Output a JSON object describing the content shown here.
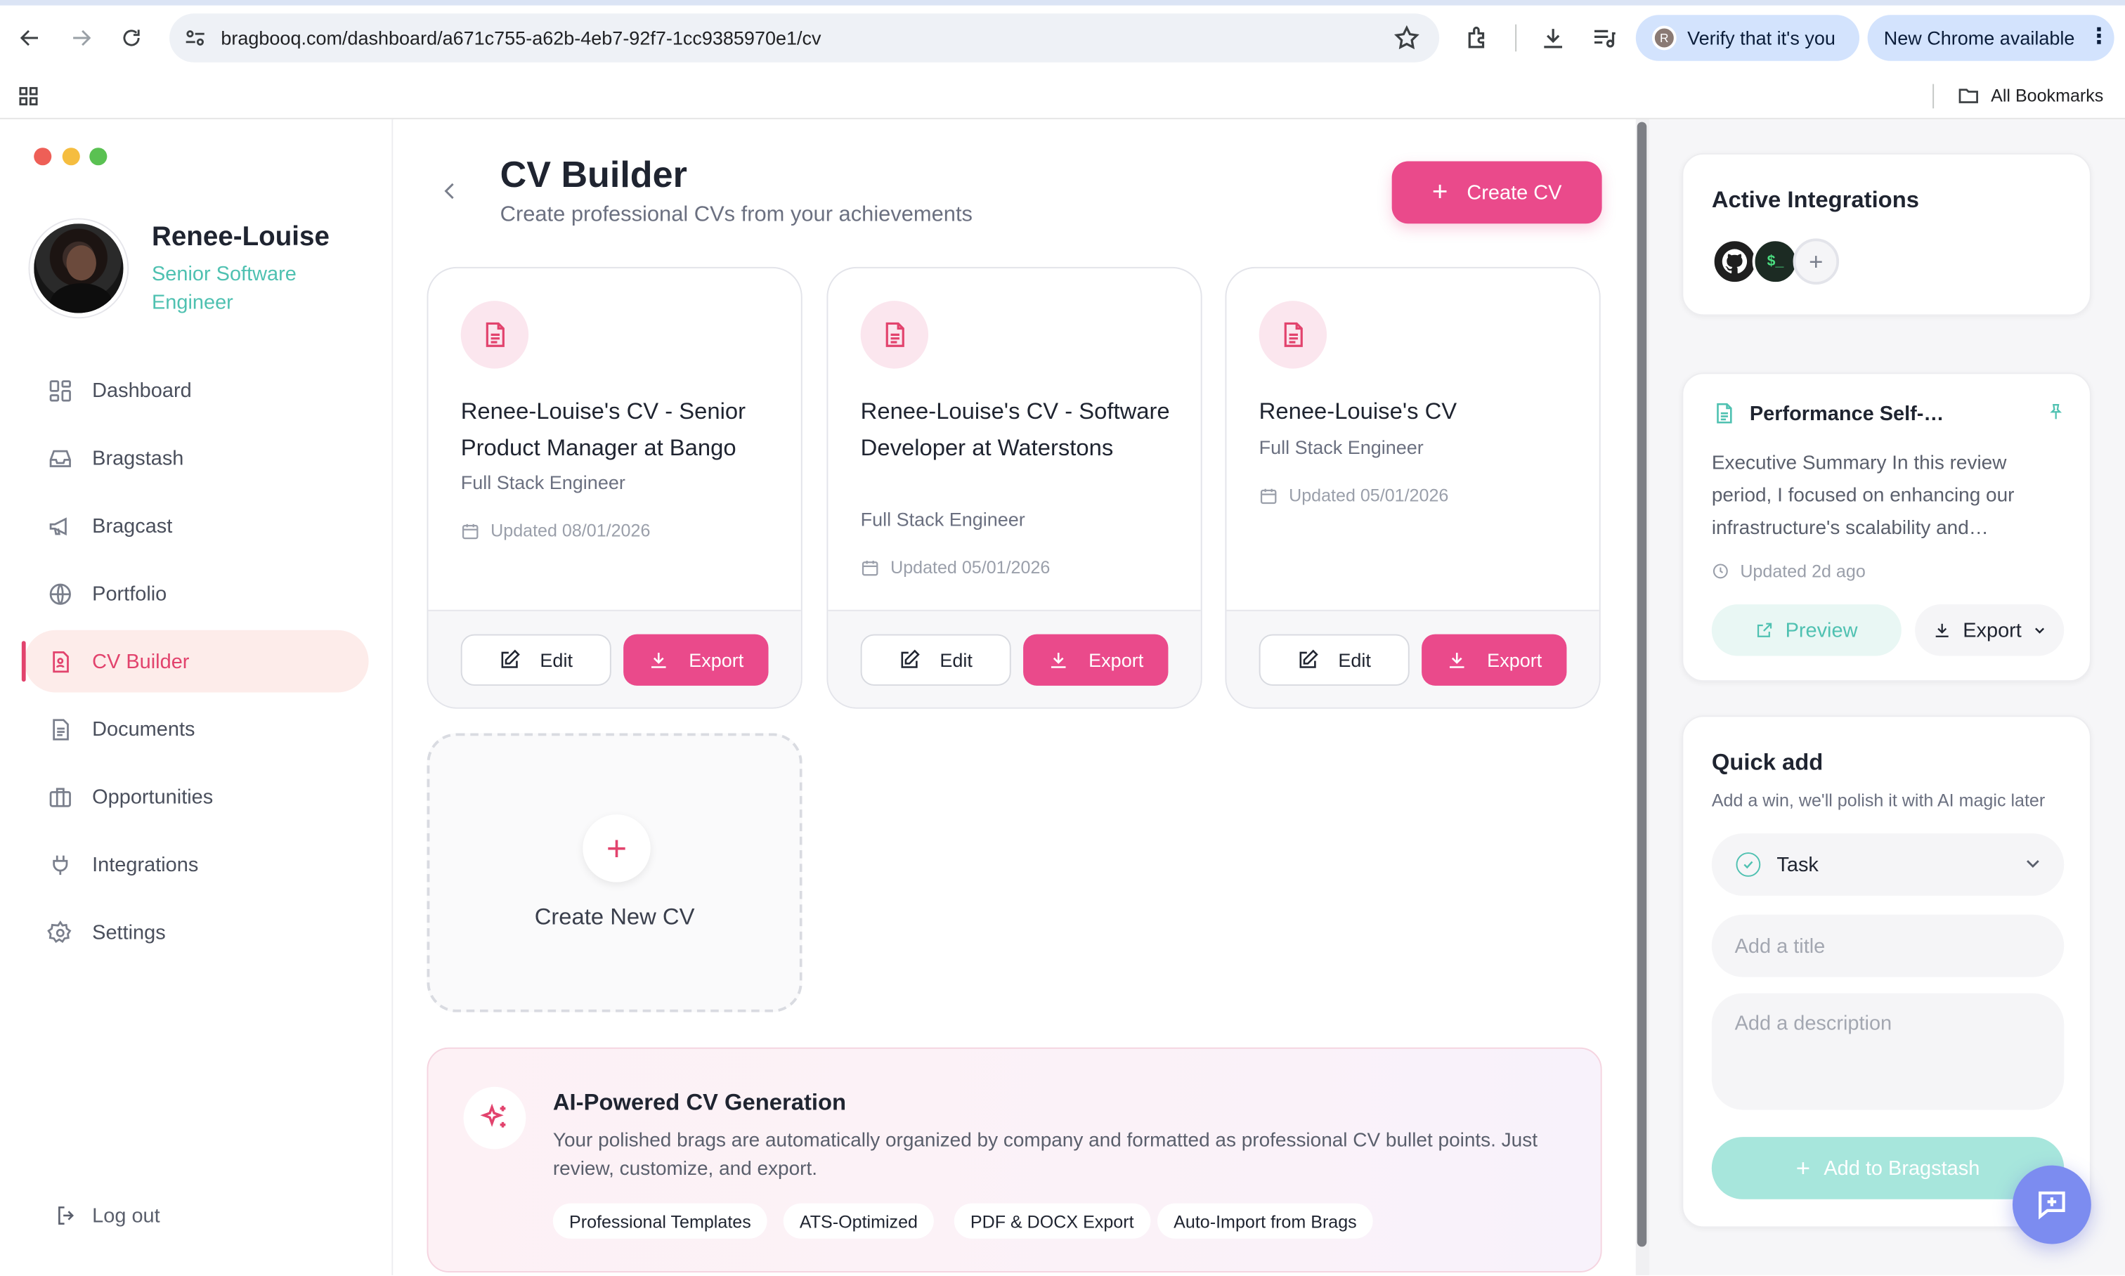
{
  "browser": {
    "url": "bragbooq.com/dashboard/a671c755-a62b-4eb7-92f7-1cc9385970e1/cv",
    "verify_label": "Verify that it's you",
    "verify_avatar_initial": "R",
    "new_chrome_label": "New Chrome available",
    "all_bookmarks_label": "All Bookmarks"
  },
  "profile": {
    "name": "Renee-Louise",
    "role": "Senior Software Engineer"
  },
  "sidebar": {
    "items": [
      {
        "label": "Dashboard",
        "icon": "grid-icon"
      },
      {
        "label": "Bragstash",
        "icon": "inbox-icon"
      },
      {
        "label": "Bragcast",
        "icon": "megaphone-icon"
      },
      {
        "label": "Portfolio",
        "icon": "globe-icon"
      },
      {
        "label": "CV Builder",
        "icon": "cv-icon",
        "active": true
      },
      {
        "label": "Documents",
        "icon": "document-icon"
      },
      {
        "label": "Opportunities",
        "icon": "briefcase-icon"
      },
      {
        "label": "Integrations",
        "icon": "plug-icon"
      },
      {
        "label": "Settings",
        "icon": "gear-icon"
      }
    ],
    "logout_label": "Log out"
  },
  "main": {
    "title": "CV Builder",
    "subtitle": "Create professional CVs from your achievements",
    "create_button_label": "Create CV",
    "cards": [
      {
        "title": "Renee-Louise's CV - Senior Product Manager at Bango",
        "role": "Full Stack Engineer",
        "updated": "Updated 08/01/2026"
      },
      {
        "title": "Renee-Louise's CV - Software Developer at Waterstons",
        "role": "Full Stack Engineer",
        "updated": "Updated 05/01/2026"
      },
      {
        "title": "Renee-Louise's CV",
        "role": "Full Stack Engineer",
        "updated": "Updated 05/01/2026"
      }
    ],
    "edit_label": "Edit",
    "export_label": "Export",
    "new_cv_label": "Create New CV",
    "ai": {
      "title": "AI-Powered CV Generation",
      "text": "Your polished brags are automatically organized by company and formatted as professional CV bullet points. Just review, customize, and export.",
      "tags": [
        "Professional Templates",
        "ATS-Optimized",
        "PDF & DOCX Export",
        "Auto-Import from Brags"
      ]
    }
  },
  "right": {
    "integrations_title": "Active Integrations",
    "integrations": [
      {
        "name": "github-icon"
      },
      {
        "name": "terminal-icon",
        "label": "$_"
      }
    ],
    "performance": {
      "title": "Performance Self-…",
      "text": "Executive Summary In this review period, I focused on enhancing our infrastructure's scalability and…",
      "updated": "Updated 2d ago",
      "preview_label": "Preview",
      "export_label": "Export"
    },
    "quick_add": {
      "title": "Quick add",
      "subtitle": "Add a win, we'll polish it with AI magic later",
      "type_selected": "Task",
      "title_placeholder": "Add a title",
      "description_placeholder": "Add a description",
      "add_button_label": "Add to Bragstash"
    }
  },
  "colors": {
    "accent_pink": "#ea4a8b",
    "accent_teal": "#4fc1b1",
    "fab_purple": "#7c8cf0"
  }
}
